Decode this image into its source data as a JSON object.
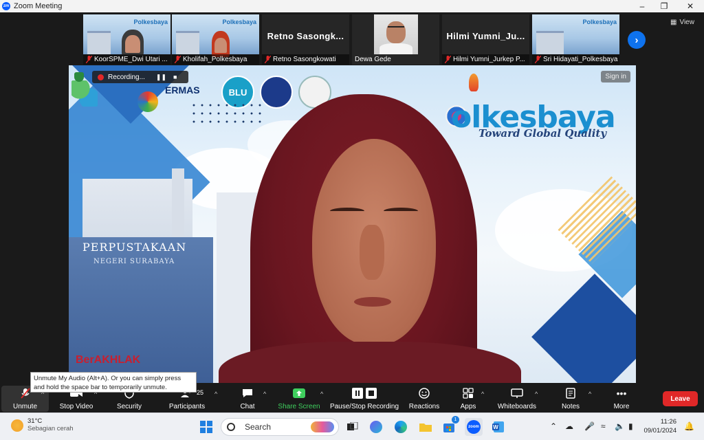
{
  "window": {
    "title": "Zoom Meeting",
    "app_icon": "zm"
  },
  "participants_strip": [
    {
      "name": "KoorSPME_Dwi Utari ...",
      "muted": true,
      "type": "video",
      "brand": "Polkesbaya"
    },
    {
      "name": "Kholifah_Polkesbaya",
      "muted": true,
      "type": "video",
      "brand": "Polkesbaya"
    },
    {
      "name": "Retno Sasongkowati",
      "muted": true,
      "type": "name",
      "display": "Retno  Sasongk..."
    },
    {
      "name": "Dewa Gede",
      "muted": false,
      "type": "video"
    },
    {
      "name": "Hilmi Yumni_Jurkep P...",
      "muted": true,
      "type": "name",
      "display": "Hilmi  Yumni_Ju..."
    },
    {
      "name": "Sri Hidayati_Polkesbaya",
      "muted": true,
      "type": "video",
      "brand": "Polkesbaya"
    }
  ],
  "view_button": "View",
  "stage": {
    "recording_label": "Recording...",
    "sign_in_label": "Sign in",
    "brand_name": "olkesbaya",
    "brand_tagline": "Toward Global Quality",
    "germas_label": "ERMAS",
    "blu_label": "BLU",
    "building_sign": "PERPUSTAKAAN",
    "building_sign_sub": "NEGERI SURABAYA",
    "berakhlak_label": "BerAKHLAK"
  },
  "tooltip": "Unmute My Audio (Alt+A). Or you can simply press and hold the space bar to temporarily unmute.",
  "toolbar": {
    "unmute": "Unmute",
    "stop_video": "Stop Video",
    "security": "Security",
    "participants": "Participants",
    "participants_count": "25",
    "chat": "Chat",
    "share_screen": "Share Screen",
    "pause_stop_recording": "Pause/Stop Recording",
    "reactions": "Reactions",
    "apps": "Apps",
    "whiteboards": "Whiteboards",
    "notes": "Notes",
    "more": "More",
    "leave": "Leave"
  },
  "taskbar": {
    "temperature": "31°C",
    "weather_desc": "Sebagian cerah",
    "search_placeholder": "Search",
    "store_badge": "1",
    "time": "11:26",
    "date": "09/01/2024"
  },
  "colors": {
    "accent_blue": "#0e72ed",
    "leave_red": "#e02828",
    "share_green": "#3fcf5e",
    "brand_blue": "#1b8fd0"
  }
}
